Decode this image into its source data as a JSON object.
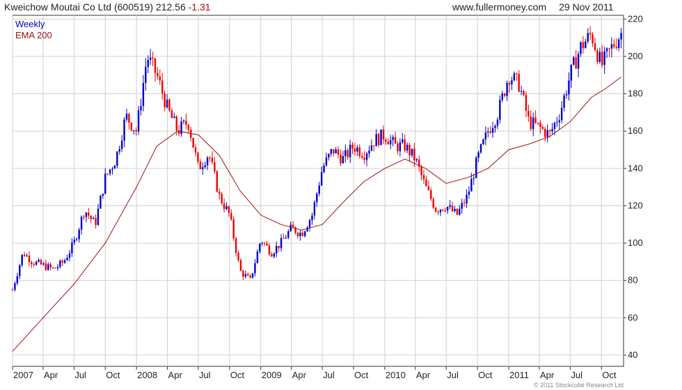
{
  "header": {
    "ticker": "Kweichow Moutai Co Ltd (600519)",
    "price": "212.56",
    "change": "-1.31",
    "website": "www.fullermoney.com",
    "date": "29 Nov 2011"
  },
  "footer": {
    "copyright": "© 2011 Stockcube Research Ltd"
  },
  "chart_data": {
    "type": "line",
    "chart_style": "candlestick",
    "legend": {
      "position": "top-left",
      "items": [
        "Weekly",
        "EMA 200"
      ]
    },
    "colors": {
      "up": "#0000cc",
      "down": "#ee0000",
      "ema": "#a01010",
      "grid": "#d0d0d0"
    },
    "grid": true,
    "y_axis": {
      "position": "right",
      "ylim": [
        34,
        222
      ],
      "ticks": [
        40,
        60,
        80,
        100,
        120,
        140,
        160,
        180,
        200,
        220
      ]
    },
    "x_axis": {
      "labels": [
        "2007",
        "Apr",
        "Jul",
        "Oct",
        "2008",
        "Apr",
        "Jul",
        "Oct",
        "2009",
        "Apr",
        "Jul",
        "Oct",
        "2010",
        "Apr",
        "Jul",
        "Oct",
        "2011",
        "Apr",
        "Jul",
        "Oct"
      ],
      "xlim": [
        "2007-01-01",
        "2011-12-05"
      ]
    },
    "series": [
      {
        "name": "Weekly",
        "x": [
          "2007-01-01",
          "2007-02-01",
          "2007-03-01",
          "2007-04-01",
          "2007-05-01",
          "2007-06-01",
          "2007-07-01",
          "2007-08-01",
          "2007-09-01",
          "2007-10-01",
          "2007-11-01",
          "2007-12-01",
          "2008-01-01",
          "2008-02-01",
          "2008-03-01",
          "2008-04-01",
          "2008-05-01",
          "2008-06-01",
          "2008-07-01",
          "2008-08-01",
          "2008-09-01",
          "2008-10-01",
          "2008-11-01",
          "2008-12-01",
          "2009-01-01",
          "2009-02-01",
          "2009-03-01",
          "2009-04-01",
          "2009-05-01",
          "2009-06-01",
          "2009-07-01",
          "2009-08-01",
          "2009-09-01",
          "2009-10-01",
          "2009-11-01",
          "2009-12-01",
          "2010-01-01",
          "2010-02-01",
          "2010-03-01",
          "2010-04-01",
          "2010-05-01",
          "2010-06-01",
          "2010-07-01",
          "2010-08-01",
          "2010-09-01",
          "2010-10-01",
          "2010-11-01",
          "2010-12-01",
          "2011-01-01",
          "2011-02-01",
          "2011-03-01",
          "2011-04-01",
          "2011-05-01",
          "2011-06-01",
          "2011-07-01",
          "2011-08-01",
          "2011-09-01",
          "2011-10-01",
          "2011-11-01",
          "2011-11-28"
        ],
        "values": [
          75,
          95,
          90,
          88,
          86,
          90,
          100,
          118,
          110,
          135,
          145,
          168,
          160,
          200,
          190,
          172,
          160,
          165,
          140,
          148,
          125,
          115,
          85,
          80,
          102,
          95,
          100,
          108,
          105,
          115,
          140,
          150,
          145,
          152,
          148,
          155,
          158,
          152,
          152,
          145,
          130,
          118,
          120,
          115,
          125,
          145,
          160,
          170,
          190,
          185,
          165,
          162,
          158,
          170,
          190,
          205,
          212,
          195,
          205,
          212.56
        ]
      },
      {
        "name": "EMA 200",
        "x": [
          "2007-01-01",
          "2007-04-01",
          "2007-07-01",
          "2007-10-01",
          "2008-01-01",
          "2008-03-01",
          "2008-05-01",
          "2008-07-01",
          "2008-09-01",
          "2008-11-01",
          "2009-01-01",
          "2009-03-01",
          "2009-05-01",
          "2009-07-01",
          "2009-09-01",
          "2009-11-01",
          "2010-01-01",
          "2010-03-01",
          "2010-05-01",
          "2010-07-01",
          "2010-09-01",
          "2010-11-01",
          "2011-01-01",
          "2011-03-01",
          "2011-05-01",
          "2011-07-01",
          "2011-09-01",
          "2011-10-15",
          "2011-11-28"
        ],
        "values": [
          42,
          60,
          78,
          100,
          130,
          152,
          160,
          158,
          147,
          128,
          115,
          110,
          107,
          110,
          122,
          133,
          140,
          145,
          140,
          132,
          135,
          140,
          150,
          153,
          157,
          165,
          178,
          183,
          189
        ]
      }
    ]
  }
}
